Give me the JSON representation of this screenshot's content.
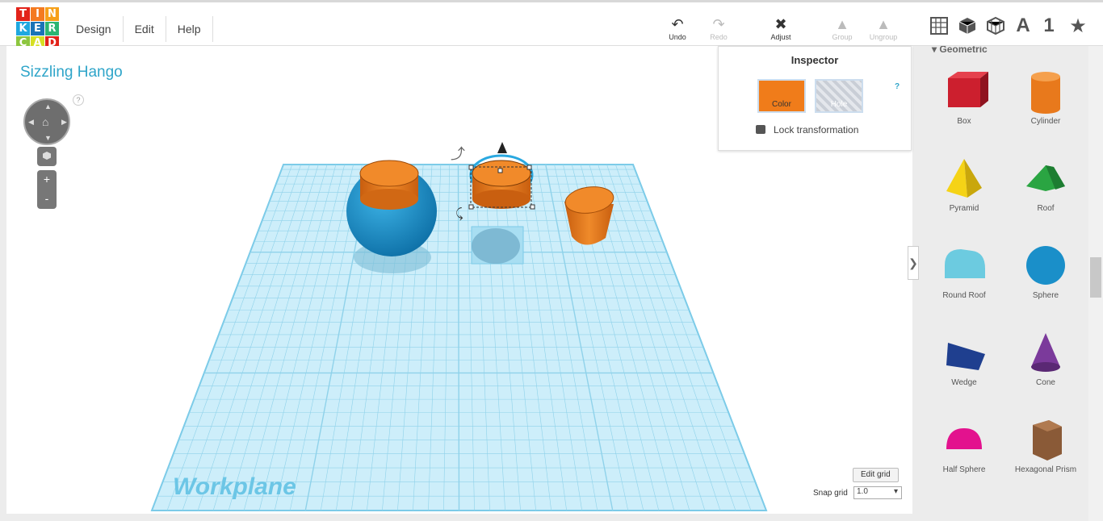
{
  "logo": {
    "letters": [
      "T",
      "I",
      "N",
      "K",
      "E",
      "R",
      "C",
      "A",
      "D"
    ],
    "colors": [
      "#e2231a",
      "#f47a20",
      "#f6a01a",
      "#1fa8e0",
      "#1a73b7",
      "#2bb673",
      "#8dc63f",
      "#d6df23",
      "#e2231a"
    ]
  },
  "menu": [
    "Design",
    "Edit",
    "Help"
  ],
  "toolbar": {
    "undo": {
      "label": "Undo",
      "icon": "undo-icon"
    },
    "redo": {
      "label": "Redo",
      "icon": "redo-icon"
    },
    "adjust": {
      "label": "Adjust",
      "icon": "adjust-icon"
    },
    "group": {
      "label": "Group",
      "icon": "group-icon"
    },
    "ungroup": {
      "label": "Ungroup",
      "icon": "ungroup-icon"
    }
  },
  "view_tools": {
    "text_tool": "A",
    "number_tool": "1",
    "favorites": "★"
  },
  "project_title": "Sizzling Hango",
  "help_mark": "?",
  "inspector": {
    "title": "Inspector",
    "color_label": "Color",
    "color_value": "#f07c1a",
    "hole_label": "Hole",
    "help": "?",
    "lock_label": "Lock transformation"
  },
  "workplane_label": "Workplane",
  "edit_grid_label": "Edit grid",
  "snap_grid_label": "Snap grid",
  "snap_grid_value": "1.0",
  "sidebar": {
    "section": "Geometric",
    "shapes": [
      {
        "label": "Box",
        "color": "#cc1f2e"
      },
      {
        "label": "Cylinder",
        "color": "#e8791c"
      },
      {
        "label": "Pyramid",
        "color": "#f5d316"
      },
      {
        "label": "Roof",
        "color": "#2aa542"
      },
      {
        "label": "Round Roof",
        "color": "#6ccbe0"
      },
      {
        "label": "Sphere",
        "color": "#1a8fc9"
      },
      {
        "label": "Wedge",
        "color": "#1f3f8f"
      },
      {
        "label": "Cone",
        "color": "#7b3a9b"
      },
      {
        "label": "Half Sphere",
        "color": "#e3128e"
      },
      {
        "label": "Hexagonal Prism",
        "color": "#8a5a37"
      }
    ]
  },
  "colors": {
    "accent": "#2fa5c9",
    "grid": "#9ad7ee",
    "sphere": "#1a8fc9",
    "orange": "#e8791c"
  }
}
